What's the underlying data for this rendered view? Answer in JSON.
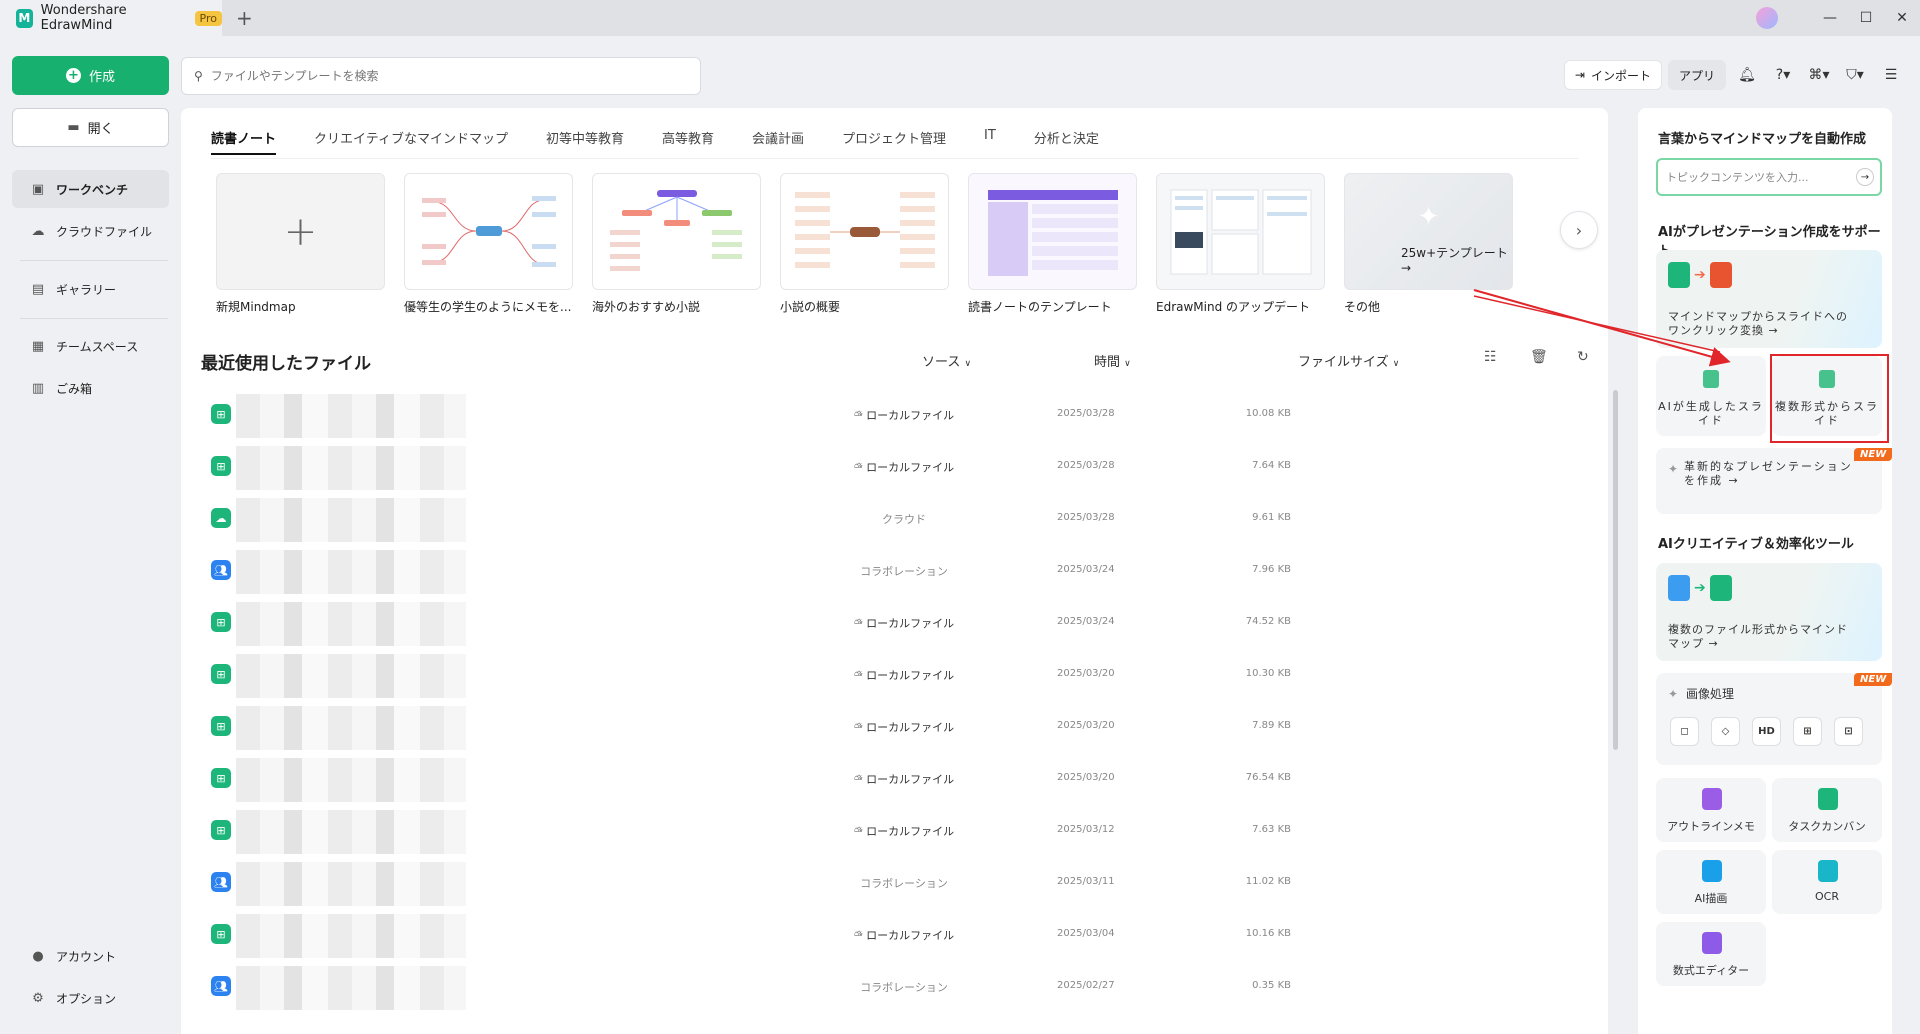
{
  "titlebar": {
    "app_title": "Wondershare EdrawMind",
    "pro_badge": "Pro",
    "new_tab": "+",
    "minimize": "—",
    "maximize": "☐",
    "close": "✕"
  },
  "sidebar": {
    "create_label": "作成",
    "open_label": "開く",
    "items": [
      {
        "label": "ワークベンチ"
      },
      {
        "label": "クラウドファイル"
      },
      {
        "label": "ギャラリー"
      },
      {
        "label": "チームスペース"
      },
      {
        "label": "ごみ箱"
      }
    ],
    "account_label": "アカウント",
    "options_label": "オプション"
  },
  "search": {
    "placeholder": "ファイルやテンプレートを検索"
  },
  "toolbar": {
    "import_label": "インポート",
    "app_label": "アプリ"
  },
  "categories": [
    "読書ノート",
    "クリエイティブなマインドマップ",
    "初等中等教育",
    "高等教育",
    "会議計画",
    "プロジェクト管理",
    "IT",
    "分析と決定"
  ],
  "templates": [
    {
      "name": "新規Mindmap"
    },
    {
      "name": "優等生の学生のようにメモを..."
    },
    {
      "name": "海外のおすすめ小説"
    },
    {
      "name": "小説の概要"
    },
    {
      "name": "読書ノートのテンプレート"
    },
    {
      "name": "EdrawMind のアップデート"
    },
    {
      "name": "その他"
    }
  ],
  "more_templates_label": "25w+テンプレート →",
  "recent": {
    "title": "最近使用したファイル",
    "col_source": "ソース",
    "col_time": "時間",
    "col_size": "ファイルサイズ",
    "rows": [
      {
        "type": "local",
        "source": "ローカルファイル",
        "date": "2025/03/28",
        "size": "10.08 KB"
      },
      {
        "type": "local",
        "source": "ローカルファイル",
        "date": "2025/03/28",
        "size": "7.64 KB"
      },
      {
        "type": "cloud",
        "source": "クラウド",
        "date": "2025/03/28",
        "size": "9.61 KB"
      },
      {
        "type": "collab",
        "source": "コラボレーション",
        "date": "2025/03/24",
        "size": "7.96 KB"
      },
      {
        "type": "local",
        "source": "ローカルファイル",
        "date": "2025/03/24",
        "size": "74.52 KB"
      },
      {
        "type": "local",
        "source": "ローカルファイル",
        "date": "2025/03/20",
        "size": "10.30 KB"
      },
      {
        "type": "local",
        "source": "ローカルファイル",
        "date": "2025/03/20",
        "size": "7.89 KB"
      },
      {
        "type": "local",
        "source": "ローカルファイル",
        "date": "2025/03/20",
        "size": "76.54 KB"
      },
      {
        "type": "local",
        "source": "ローカルファイル",
        "date": "2025/03/12",
        "size": "7.63 KB"
      },
      {
        "type": "collab",
        "source": "コラボレーション",
        "date": "2025/03/11",
        "size": "11.02 KB"
      },
      {
        "type": "local",
        "source": "ローカルファイル",
        "date": "2025/03/04",
        "size": "10.16 KB"
      },
      {
        "type": "collab",
        "source": "コラボレーション",
        "date": "2025/02/27",
        "size": "0.35 KB"
      }
    ]
  },
  "right": {
    "ai_text_title": "言葉からマインドマップを自動作成",
    "topic_placeholder": "トピックコンテンツを入力...",
    "ai_pres_title": "AIがプレゼンテーション作成をサポート",
    "mm_to_slide": "マインドマップからスライドへのワンクリック変換",
    "ai_slides": "AIが生成したスライド",
    "multi_to_slides": "複数形式からスライド",
    "new_badge": "NEW",
    "innovative_pres": "革新的なプレゼンテーションを作成",
    "ai_tools_title": "AIクリエイティブ＆効率化ツール",
    "multi_to_mm": "複数のファイル形式からマインドマップ",
    "image_processing": "画像処理",
    "tools": [
      {
        "label": "アウトラインメモ",
        "color": "#9b5de5"
      },
      {
        "label": "タスクカンバン",
        "color": "#1db57a"
      },
      {
        "label": "AI描画",
        "color": "#1aa0e8"
      },
      {
        "label": "OCR",
        "color": "#19b6c9"
      },
      {
        "label": "数式エディター",
        "color": "#8e5be8"
      }
    ]
  },
  "colors": {
    "accent": "#17b06e",
    "highlight": "#e0262b",
    "new_badge": "#f26b1d"
  }
}
